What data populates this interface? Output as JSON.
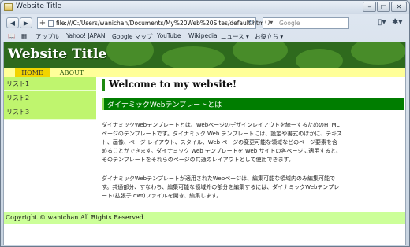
{
  "window": {
    "title": "Website Title"
  },
  "navigation": {
    "back_icon": "back-arrow-icon",
    "forward_icon": "forward-arrow-icon",
    "address": "file:///C:/Users/wanichan/Documents/My%20Web%20Sites/default.htm",
    "search_placeholder": "Google"
  },
  "bookmarks": [
    "アップル",
    "Yahoo! JAPAN",
    "Google マップ",
    "YouTube",
    "Wikipedia",
    "ニュース ▾",
    "お役立ち ▾"
  ],
  "site": {
    "title": "Website Title",
    "menu": [
      "HOME",
      "ABOUT"
    ],
    "sidebar": [
      "リスト1",
      "リスト2",
      "リスト3"
    ],
    "welcome": "Welcome to my website!",
    "subheading": "ダイナミックWebテンプレートとは",
    "paragraph1": [
      "ダイナミックWebテンプレートとは、Webページのデザインレイアウトを統一するためのHTML",
      "ページのテンプレートです。ダイナミック Web テンプレートには、設定や書式のほかに、テキス",
      "ト、画像、ページ レイアウト、スタイル、Web ページの変更可能な領域などのページ要素を含",
      "めることができます。ダイナミック Web テンプレートを Web サイトの各ページに適用すると、",
      "そのテンプレートをそれらのページの共通のレイアウトとして使用できます。"
    ],
    "paragraph2": [
      "ダイナミックWebテンプレートが適用されたWebページは、編集可能な領域内のみ編集可能で",
      "す。共通部分、すなわち、編集可能な領域外の部分を編集するには、ダイナミックWebテンプレ",
      "ート(拡張子.dwt)ファイルを開き、編集します。"
    ],
    "footer": "Copyright © wanichan All Rights Reserved."
  },
  "colors": {
    "header_green": "#2e6a1d",
    "menu_yellow": "#ffff99",
    "menu_active": "#f2d400",
    "sidebar_green": "#bff56e",
    "subhead_green": "#007d00",
    "footer_green": "#ccff99"
  }
}
